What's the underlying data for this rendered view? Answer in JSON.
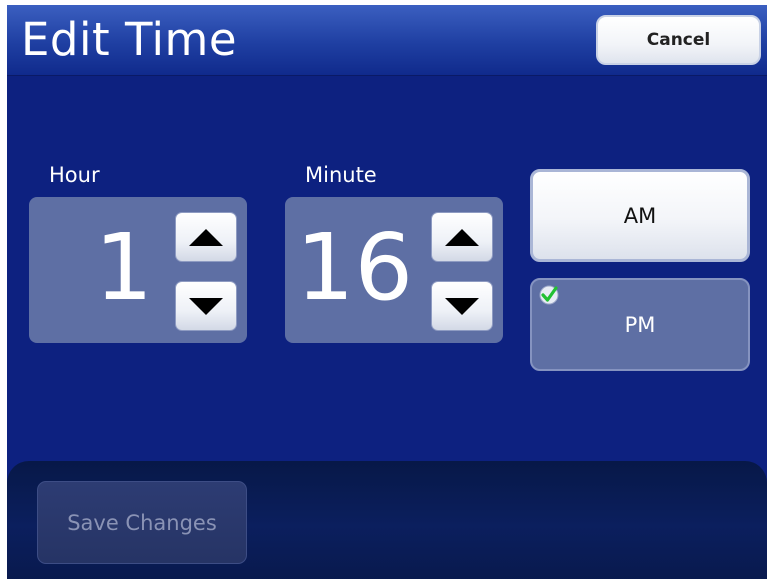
{
  "header": {
    "title": "Edit Time",
    "cancel_label": "Cancel"
  },
  "hour": {
    "label": "Hour",
    "value": "1"
  },
  "minute": {
    "label": "Minute",
    "value": "16"
  },
  "period": {
    "am_label": "AM",
    "pm_label": "PM",
    "selected": "PM"
  },
  "footer": {
    "save_label": "Save Changes",
    "save_enabled": false
  },
  "icons": {
    "up": "arrow-up-icon",
    "down": "arrow-down-icon",
    "check": "check-icon"
  },
  "colors": {
    "background": "#0d2180",
    "header": "#2848b0",
    "field": "#5e6fa4",
    "check": "#2ecc40"
  }
}
